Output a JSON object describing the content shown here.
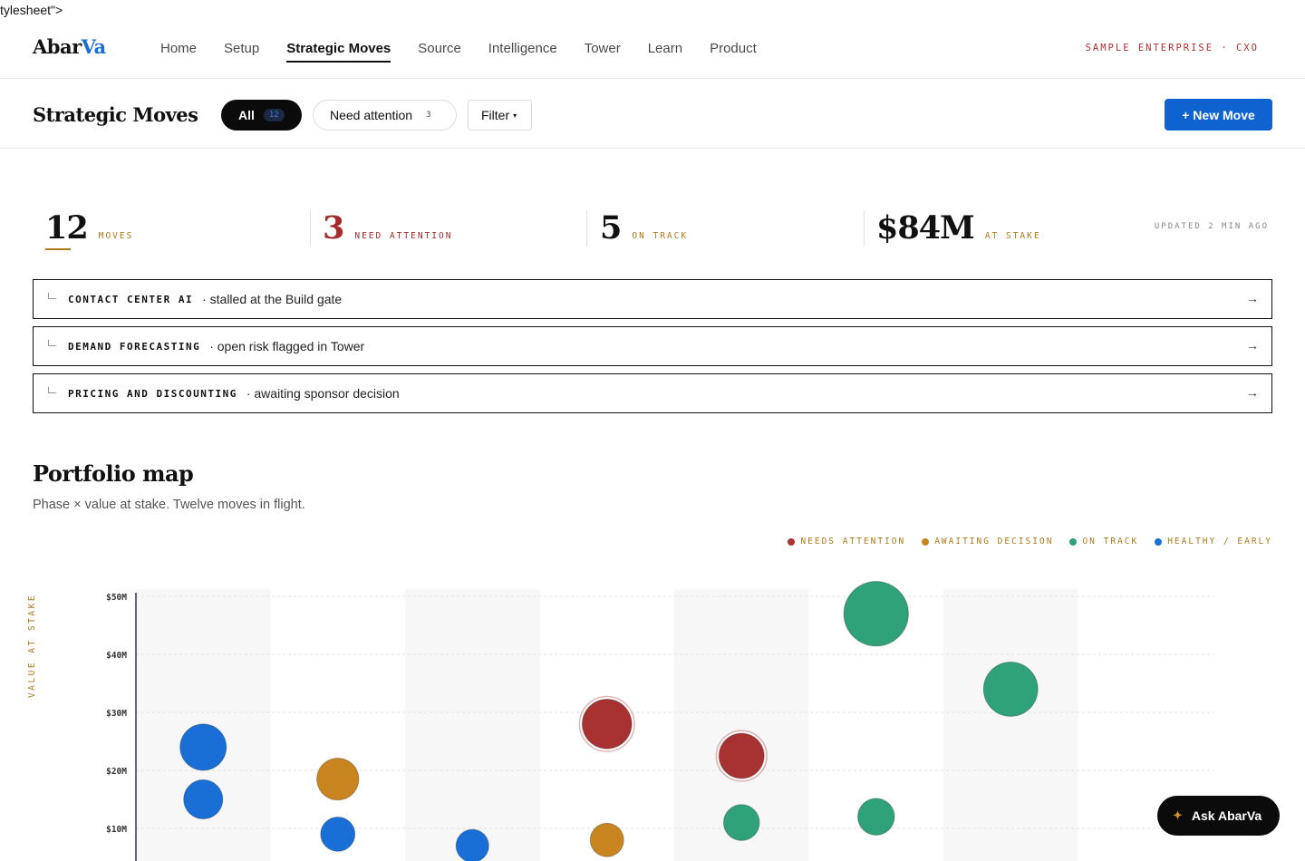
{
  "stray_text": "tylesheet\">",
  "brand": {
    "part1": "Abar",
    "part2": "Va"
  },
  "nav": {
    "items": [
      "Home",
      "Setup",
      "Strategic Moves",
      "Source",
      "Intelligence",
      "Tower",
      "Learn",
      "Product"
    ],
    "active": "Strategic Moves",
    "enterprise": "SAMPLE ENTERPRISE · CXO"
  },
  "header": {
    "title": "Strategic Moves",
    "all_label": "All",
    "all_count": "12",
    "need_label": "Need attention",
    "need_count": "3",
    "filter_label": "Filter",
    "filter_caret": "▾",
    "new_move_label": "+ New Move"
  },
  "stats": {
    "moves": {
      "value": "12",
      "label": "MOVES"
    },
    "attention": {
      "value": "3",
      "label": "NEED ATTENTION"
    },
    "on_track": {
      "value": "5",
      "label": "ON TRACK"
    },
    "at_stake": {
      "value": "$84M",
      "label": "AT STAKE"
    },
    "updated": "UPDATED 2 MIN AGO"
  },
  "alerts": [
    {
      "name": "CONTACT CENTER AI",
      "desc": "· stalled at the Build gate",
      "arrow": "→"
    },
    {
      "name": "DEMAND FORECASTING",
      "desc": "· open risk flagged in Tower",
      "arrow": "→"
    },
    {
      "name": "PRICING AND DISCOUNTING",
      "desc": "· awaiting sponsor decision",
      "arrow": "→"
    }
  ],
  "portfolio": {
    "title": "Portfolio map",
    "subtitle": "Phase × value at stake. Twelve moves in flight.",
    "legend": [
      {
        "label": "NEEDS ATTENTION",
        "color": "#a83232"
      },
      {
        "label": "AWAITING DECISION",
        "color": "#c8841f"
      },
      {
        "label": "ON TRACK",
        "color": "#2fa27a"
      },
      {
        "label": "HEALTHY / EARLY",
        "color": "#1a6fd6"
      }
    ]
  },
  "chart_data": {
    "type": "scatter",
    "ylabel": "VALUE AT STAKE",
    "y_ticks": [
      "$10M",
      "$20M",
      "$30M",
      "$40M",
      "$50M"
    ],
    "ylim": [
      10,
      50
    ],
    "phases": 8,
    "points": [
      {
        "phase": 1,
        "value": 24,
        "status": "healthy"
      },
      {
        "phase": 1,
        "value": 15,
        "status": "healthy"
      },
      {
        "phase": 2,
        "value": 18.5,
        "status": "awaiting"
      },
      {
        "phase": 2,
        "value": 9,
        "status": "healthy"
      },
      {
        "phase": 3,
        "value": 7,
        "status": "healthy"
      },
      {
        "phase": 4,
        "value": 28,
        "status": "attention"
      },
      {
        "phase": 4,
        "value": 8,
        "status": "awaiting"
      },
      {
        "phase": 5,
        "value": 22.5,
        "status": "attention"
      },
      {
        "phase": 5,
        "value": 11,
        "status": "on_track"
      },
      {
        "phase": 6,
        "value": 47,
        "status": "on_track"
      },
      {
        "phase": 6,
        "value": 12,
        "status": "on_track"
      },
      {
        "phase": 7,
        "value": 34,
        "status": "on_track"
      }
    ]
  },
  "ask": {
    "icon": "✦",
    "label": "Ask AbarVa"
  }
}
